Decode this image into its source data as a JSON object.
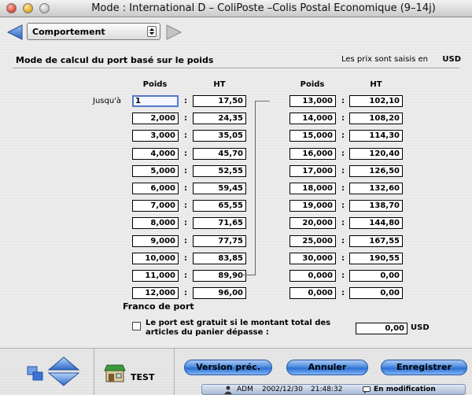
{
  "window": {
    "title": "Mode : International D – ColiPoste –Colis Postal Economique (9–14j)"
  },
  "toolbar": {
    "popup_value": "Comportement"
  },
  "section": {
    "heading": "Mode de calcul du port basé sur le poids",
    "currency_note": "Les prix sont saisis en",
    "currency": "USD"
  },
  "table": {
    "head_weight": "Poids",
    "head_price": "HT",
    "jusqua_label": "Jusqu'à",
    "separator": ":",
    "left": [
      {
        "weight": "1",
        "price": "17,50"
      },
      {
        "weight": "2,000",
        "price": "24,35"
      },
      {
        "weight": "3,000",
        "price": "35,05"
      },
      {
        "weight": "4,000",
        "price": "45,70"
      },
      {
        "weight": "5,000",
        "price": "52,55"
      },
      {
        "weight": "6,000",
        "price": "59,45"
      },
      {
        "weight": "7,000",
        "price": "65,55"
      },
      {
        "weight": "8,000",
        "price": "71,65"
      },
      {
        "weight": "9,000",
        "price": "77,75"
      },
      {
        "weight": "10,000",
        "price": "83,85"
      },
      {
        "weight": "11,000",
        "price": "89,90"
      },
      {
        "weight": "12,000",
        "price": "96,00"
      }
    ],
    "right": [
      {
        "weight": "13,000",
        "price": "102,10"
      },
      {
        "weight": "14,000",
        "price": "108,20"
      },
      {
        "weight": "15,000",
        "price": "114,30"
      },
      {
        "weight": "16,000",
        "price": "120,40"
      },
      {
        "weight": "17,000",
        "price": "126,50"
      },
      {
        "weight": "18,000",
        "price": "132,60"
      },
      {
        "weight": "19,000",
        "price": "138,70"
      },
      {
        "weight": "20,000",
        "price": "144,80"
      },
      {
        "weight": "25,000",
        "price": "167,55"
      },
      {
        "weight": "30,000",
        "price": "190,55"
      },
      {
        "weight": "0,000",
        "price": "0,00"
      },
      {
        "weight": "0,000",
        "price": "0,00"
      }
    ]
  },
  "franco": {
    "heading": "Franco de port",
    "checkbox_label": "Le port est gratuit si le montant total des articles du panier dépasse :",
    "checked": false,
    "amount": "0,00",
    "currency": "USD"
  },
  "bottom": {
    "test_label": "TEST",
    "btn_prev": "Version préc.",
    "btn_cancel": "Annuler",
    "btn_save": "Enregistrer"
  },
  "status": {
    "user": "ADM",
    "date": "2002/12/30",
    "time": "21:48:32",
    "mode": "En modification"
  },
  "colors": {
    "accent_blue": "#2c6fd3",
    "focus_ring": "#5577cc"
  },
  "icons": {
    "back": "left-arrow-icon",
    "forward": "right-arrow-icon",
    "windows": "windows-icon",
    "updown": "up-down-arrows-icon",
    "shop": "shop-icon",
    "user": "user-icon",
    "chat": "chat-icon"
  }
}
